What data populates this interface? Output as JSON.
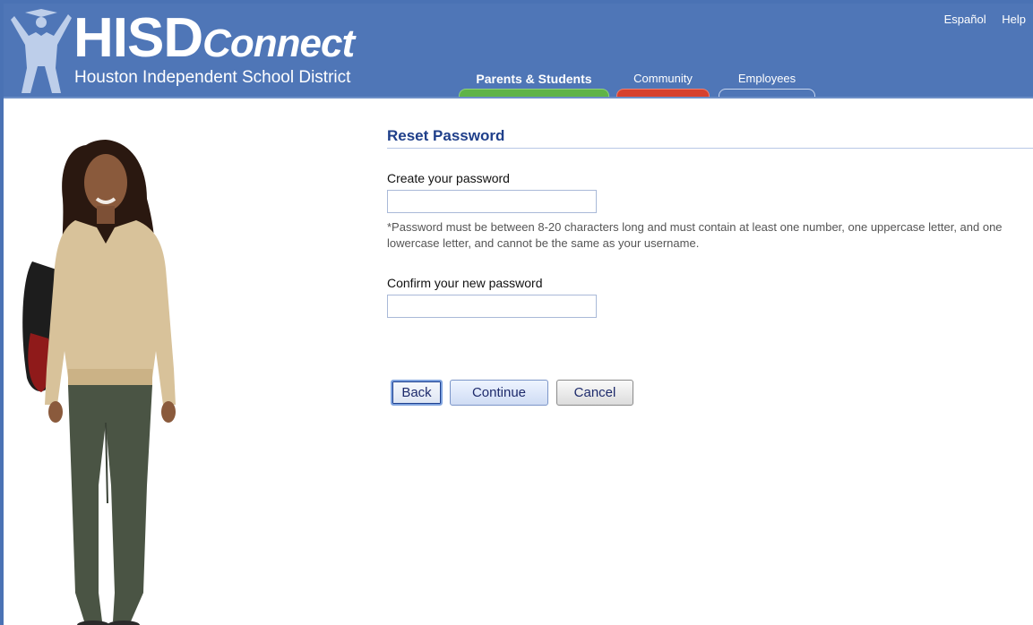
{
  "header": {
    "logo_main": "HISD",
    "logo_accent": "Connect",
    "logo_subtitle": "Houston Independent School District",
    "links": {
      "espanol": "Español",
      "help": "Help"
    },
    "tabs": [
      {
        "label": "Parents & Students",
        "color": "#5fb348"
      },
      {
        "label": "Community",
        "color": "#d6412e"
      },
      {
        "label": "Employees",
        "color": "#4f76b7"
      }
    ]
  },
  "form": {
    "title": "Reset Password",
    "password_label": "Create your password",
    "password_value": "",
    "password_hint": "*Password must be between 8-20 characters long and must contain at least one number, one uppercase letter, and one lowercase letter, and cannot be the same as your username.",
    "confirm_label": "Confirm your new password",
    "confirm_value": "",
    "buttons": {
      "back": "Back",
      "continue": "Continue",
      "cancel": "Cancel"
    }
  },
  "colors": {
    "header_bg": "#4f76b7",
    "title_text": "#1f3f8a"
  }
}
